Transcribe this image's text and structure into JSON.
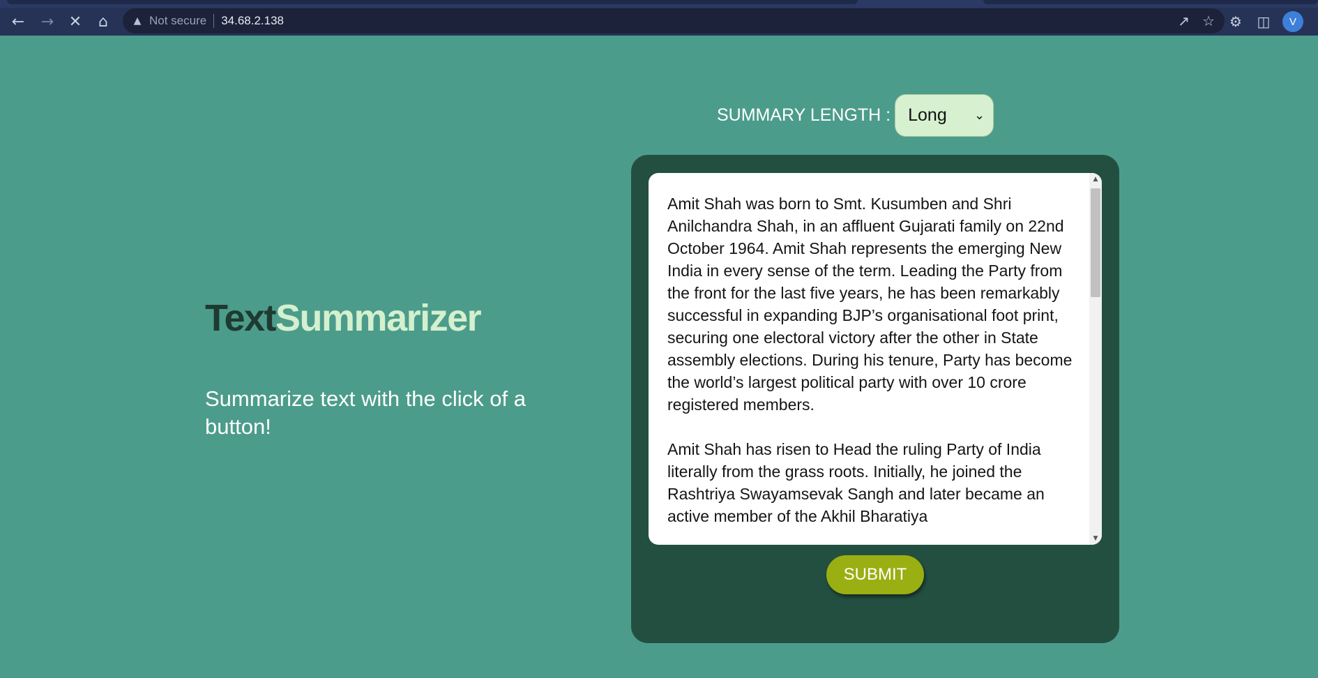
{
  "browser": {
    "security_label": "Not secure",
    "url": "34.68.2.138",
    "profile_initial": "V"
  },
  "brand": {
    "part1": "Text",
    "part2": "Summarizer"
  },
  "tagline": "Summarize text with the click of a button!",
  "summary_length": {
    "label": "SUMMARY LENGTH :",
    "selected": "Long"
  },
  "input_text": {
    "paragraph1": "Amit Shah was born to Smt. Kusumben and Shri Anilchandra Shah, in an affluent Gujarati family on 22nd October 1964. Amit Shah represents the emerging New India in every sense of the term. Leading the Party from the front for the last five years, he has been remarkably successful in expanding BJP’s organisational foot print, securing one electoral victory after the other in State assembly elections. During his tenure, Party has become the world’s largest political party with over 10 crore registered members.",
    "paragraph2": "Amit Shah has risen to Head the ruling Party of India literally from the grass roots. Initially, he joined the Rashtriya Swayamsevak Sangh and later became an active member of the Akhil Bharatiya"
  },
  "submit_label": "SUBMIT",
  "colors": {
    "page_bg": "#4c9c8b",
    "panel_bg": "#234f41",
    "brand_dark": "#1e3a31",
    "brand_light": "#d4f0cf",
    "submit_bg": "#9aaf12",
    "select_bg": "#d7f0cf"
  }
}
